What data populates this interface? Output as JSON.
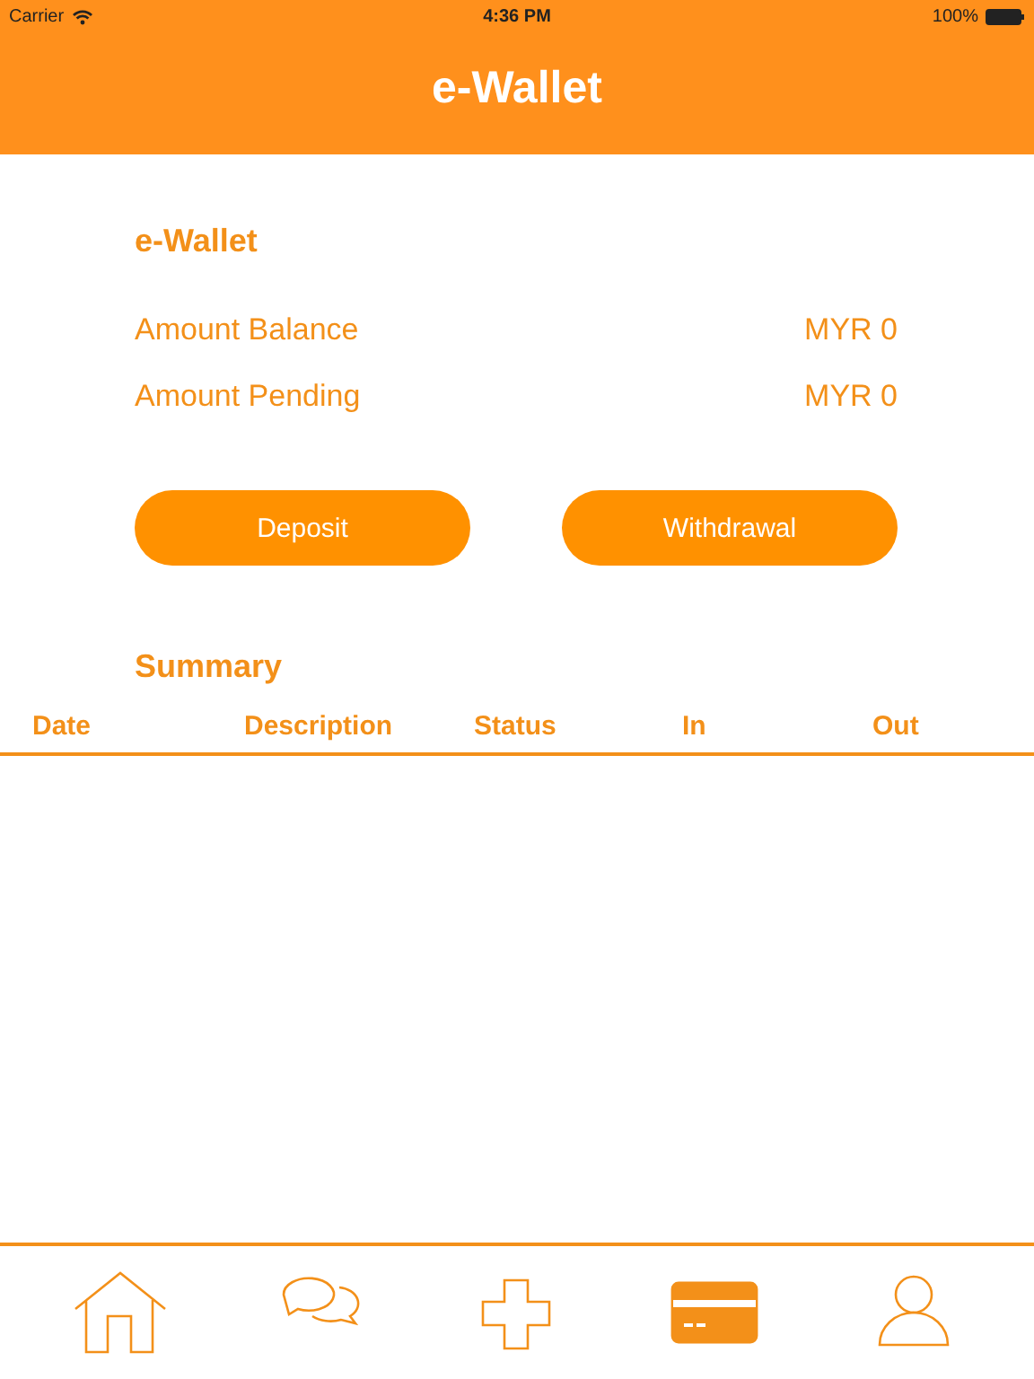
{
  "status_bar": {
    "carrier": "Carrier",
    "time": "4:36 PM",
    "battery": "100%"
  },
  "header": {
    "title": "e-Wallet"
  },
  "wallet": {
    "title": "e-Wallet",
    "rows": [
      {
        "label": "Amount Balance",
        "value": "MYR 0"
      },
      {
        "label": "Amount Pending",
        "value": "MYR 0"
      }
    ]
  },
  "buttons": [
    "Deposit",
    "Withdrawal"
  ],
  "summary": {
    "title": "Summary",
    "columns": [
      "Date",
      "Description",
      "Status",
      "In",
      "Out"
    ]
  },
  "tab_bar": [
    {
      "kind": "home",
      "selected": false
    },
    {
      "kind": "chat",
      "selected": false
    },
    {
      "kind": "plus",
      "selected": false
    },
    {
      "kind": "card",
      "selected": true
    },
    {
      "kind": "person",
      "selected": false
    }
  ]
}
